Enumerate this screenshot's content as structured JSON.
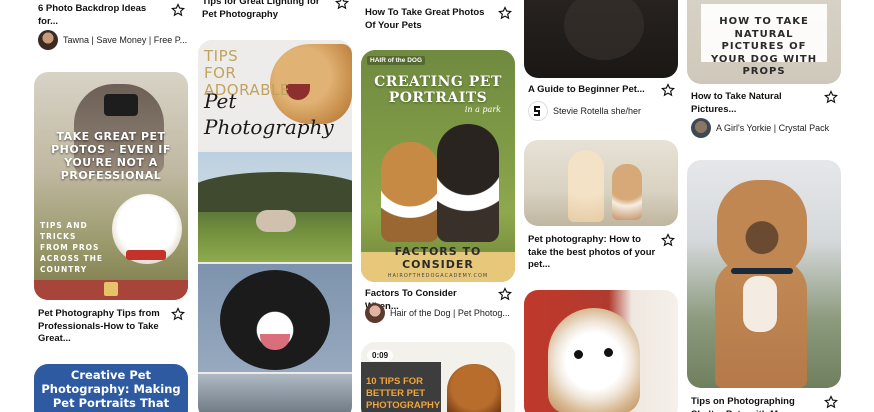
{
  "pins": [
    {
      "title": "6 Photo Backdrop Ideas for...",
      "author": "Tawna | Save Money | Free P..."
    },
    {
      "title": "Tips for Great Lighting for Pet Photography"
    },
    {
      "title": "How To Take Great Photos Of Your Pets"
    },
    {
      "title": "A Guide to Beginner Pet...",
      "author": "Stevie Rotella she/her"
    },
    {
      "title": "How to Take Natural Pictures...",
      "author": "A Girl's Yorkie | Crystal Pack",
      "image_text": "HOW TO TAKE NATURAL PICTURES OF YOUR DOG WITH PROPS"
    },
    {
      "title": "Pet Photography Tips from Professionals-How to Take Great...",
      "image_text_main": "TAKE GREAT PET PHOTOS - EVEN IF YOU'RE NOT A PROFESSIONAL",
      "image_text_sub": "TIPS AND TRICKS FROM PROS ACROSS THE COUNTRY"
    },
    {
      "image_text_main": "TIPS FOR ADORABLE",
      "image_text_script": "Pet Photography"
    },
    {
      "title": "Factors To Consider When...",
      "author": "Hair of the Dog | Pet Photog...",
      "image_brand": "HAIR of the DOG",
      "image_text_main": "CREATING PET PORTRAITS",
      "image_text_sub": "in a park",
      "image_text_footer": "FACTORS TO CONSIDER",
      "image_url_text": "HAIROFTHEDOGACADEMY.COM"
    },
    {
      "title": "Pet photography: How to take the best photos of your pet..."
    },
    {
      "title": "Tips on Photographing Shelter Pets with M..."
    },
    {
      "image_text_main": "Creative Pet Photography: Making Pet Portraits That Stand Out!"
    },
    {
      "duration": "0:09",
      "image_text_main": "10 TIPS FOR BETTER PET PHOTOGRAPHY"
    }
  ],
  "colors": {
    "page_bg": "#ffffff",
    "text": "#111111",
    "banner_red": "#a8453a",
    "portrait_gold": "#e7c77a",
    "blue_banner": "#2d5aa0",
    "orange": "#e89a1e"
  },
  "icons": {
    "save": "bookmark-outline-star"
  }
}
